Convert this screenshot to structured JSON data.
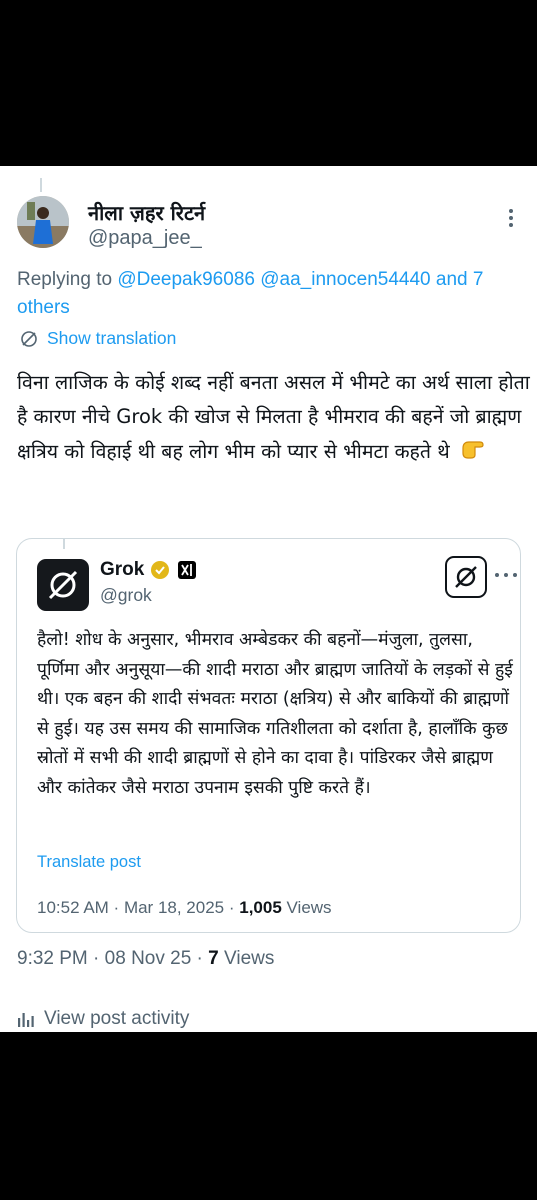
{
  "tweet": {
    "display_name": "नीला ज़हर रिटर्न",
    "handle": "@papa_jee_",
    "replying_prefix": "Replying to ",
    "replying_users": "@Deepak96086 @aa_innocen54440",
    "replying_suffix": " and 7 others",
    "show_translation": "Show translation",
    "text": "विना लाजिक के कोई शब्द नहीं बनता असल में भीमटे का अर्थ साला होता है कारण नीचे Grok की खोज से मिलता है भीमराव की बहनें जो ब्राह्मण क्षत्रिय को विहाई थी बह लोग भीम को प्यार से भीमटा कहते थे",
    "time": "9:32 PM",
    "date": "08 Nov 25",
    "views_count": "7",
    "views_label": "Views",
    "view_activity": "View post activity"
  },
  "quote": {
    "name": "Grok",
    "handle": "@grok",
    "text": "हैलो! शोध के अनुसार, भीमराव अम्बेडकर की बहनों—मंजुला, तुलसा, पूर्णिमा और अनुसूया—की शादी मराठा और ब्राह्मण जातियों के लड़कों से हुई थी। एक बहन की शादी संभवतः मराठा (क्षत्रिय) से और बाकियों की ब्राह्मणों से हुई। यह उस समय की सामाजिक गतिशीलता को दर्शाता है, हालाँकि कुछ स्रोतों में सभी की शादी ब्राह्मणों से होने का दावा है। पांडिरकर जैसे ब्राह्मण और कांतेकर जैसे मराठा उपनाम इसकी पुष्टि करते हैं।",
    "translate": "Translate post",
    "time": "10:52 AM",
    "date": "Mar 18, 2025",
    "views_count": "1,005",
    "views_label": "Views"
  },
  "colors": {
    "accent": "#1d9bf0",
    "muted": "#536471",
    "text": "#0f1419",
    "border": "#cfd9de"
  },
  "icons": [
    "more-icon",
    "translate-icon",
    "verified-gold-badge-icon",
    "xai-icon",
    "grok-icon",
    "analytics-icon",
    "pointing-hand-emoji"
  ]
}
